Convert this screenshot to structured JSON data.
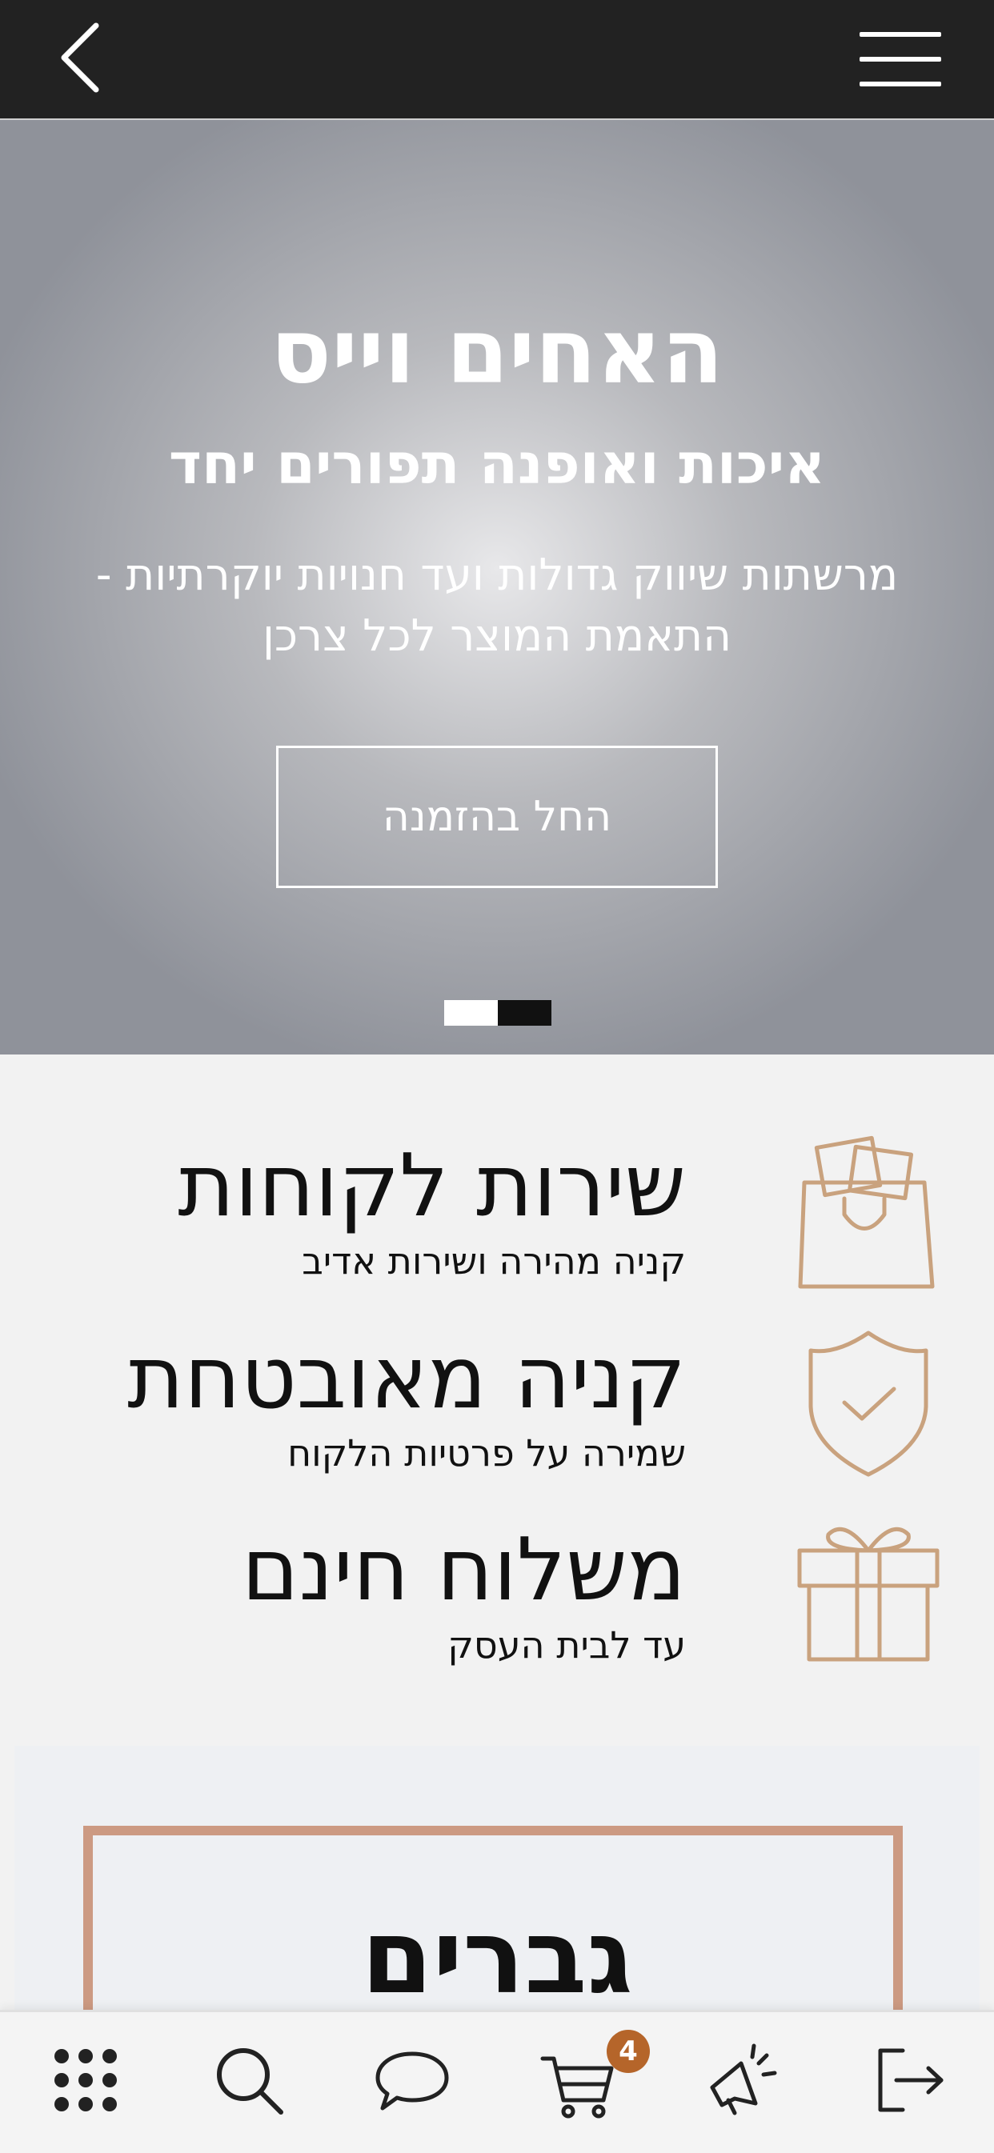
{
  "hero": {
    "title": "האחים וייס",
    "subtitle": "איכות ואופנה תפורים יחד",
    "description": "מרשתות שיווק גדולות ועד חנויות יוקרתיות - התאמת המוצר לכל צרכן",
    "cta_label": "החל בהזמנה"
  },
  "features": [
    {
      "title": "שירות לקוחות",
      "subtitle": "קניה מהירה ושירות אדיב",
      "icon": "shopping-bag-icon"
    },
    {
      "title": "קניה מאובטחת",
      "subtitle": "שמירה על פרטיות הלקוח",
      "icon": "shield-check-icon"
    },
    {
      "title": "משלוח חינם",
      "subtitle": "עד לבית העסק",
      "icon": "gift-icon"
    }
  ],
  "category": {
    "label": "גברים"
  },
  "bottom_nav": {
    "items": [
      "grid-icon",
      "search-icon",
      "chat-icon",
      "cart-icon",
      "megaphone-icon",
      "logout-icon"
    ],
    "cart_count": "4"
  },
  "colors": {
    "topbar": "#222222",
    "accent_gold": "#c9a27e",
    "badge": "#b5652a",
    "frame": "#cc9a82"
  }
}
